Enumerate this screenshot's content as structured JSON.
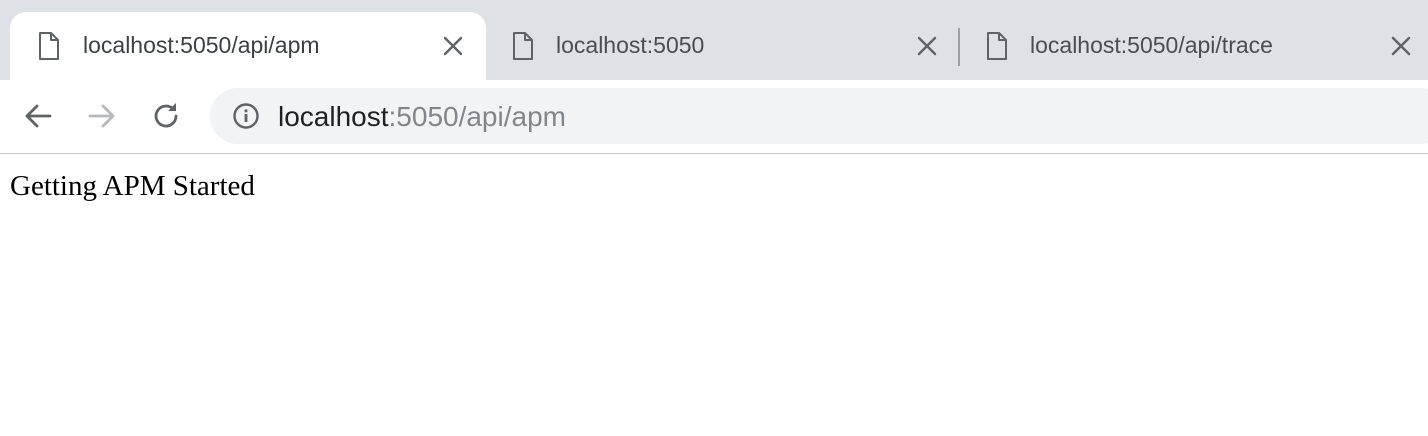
{
  "tabs": [
    {
      "title": "localhost:5050/api/apm",
      "active": true
    },
    {
      "title": "localhost:5050",
      "active": false
    },
    {
      "title": "localhost:5050/api/trace",
      "active": false
    }
  ],
  "address_bar": {
    "host": "localhost",
    "rest": ":5050/api/apm"
  },
  "page": {
    "text": "Getting APM Started"
  },
  "colors": {
    "tabstrip_bg": "#dee1e6",
    "omnibox_bg": "#f1f3f4",
    "icon": "#5f6368",
    "disabled_icon": "#b7b9bc"
  },
  "icons": {
    "tab_favicon": "file-icon",
    "tab_close": "close-icon",
    "back": "arrow-left-icon",
    "forward": "arrow-right-icon",
    "reload": "reload-icon",
    "site_info": "info-icon"
  }
}
